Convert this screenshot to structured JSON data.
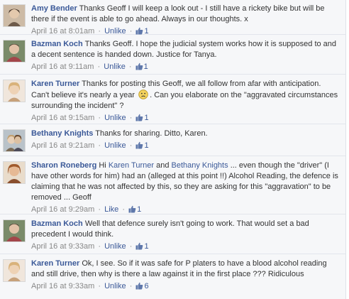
{
  "comments": [
    {
      "author": "Amy Bender",
      "text": "Thanks Geoff I will keep a look out - I still have a rickety bike but will be there if the event is able to go ahead. Always in our thoughts. x",
      "timestamp": "April 16 at 8:01am",
      "action": "Unlike",
      "likes": "1",
      "avatar_colors": [
        "#c9b8a6",
        "#6d5a4a"
      ]
    },
    {
      "author": "Bazman Koch",
      "text": "Thanks Geoff. I hope the judicial system works how it is supposed to and a decent sentence is handed down. Justice for Tanya.",
      "timestamp": "April 16 at 9:11am",
      "action": "Unlike",
      "likes": "1",
      "avatar_colors": [
        "#a3464a",
        "#e2c2a8"
      ]
    },
    {
      "author": "Karen Turner",
      "text_before": "Thanks for posting this Geoff, we all follow from afar with anticipation. Can't believe it's nearly a year",
      "text_after": ". Can you elaborate on the \"aggravated circumstances surrounding the incident\" ?",
      "emoticon": "frown-emoticon",
      "timestamp": "April 16 at 9:15am",
      "action": "Unlike",
      "likes": "1",
      "avatar_colors": [
        "#e8d3b8",
        "#c7a17a"
      ]
    },
    {
      "author": "Bethany Knights",
      "text": "Thanks for sharing. Ditto, Karen.",
      "timestamp": "April 16 at 9:21am",
      "action": "Unlike",
      "likes": "1",
      "avatar_colors": [
        "#c8bca8",
        "#7a6a55"
      ]
    },
    {
      "author": "Sharon Roneberg",
      "text_prefix": "Hi",
      "mention1": "Karen Turner",
      "text_and": "and",
      "mention2": "Bethany Knights",
      "text_rest": "... even though the \"driver\" (I have other words for him) had an (alleged at this point !!) Alcohol Reading, the defence is claiming that he was not affected by this, so they are asking for this \"aggravation\" to be removed ... Geoff",
      "timestamp": "April 16 at 9:29am",
      "action": "Like",
      "likes": "1",
      "avatar_colors": [
        "#d9a67c",
        "#8a4f2e"
      ]
    },
    {
      "author": "Bazman Koch",
      "text": "Well that defence surely isn't going to work. That would set a bad precedent I would think.",
      "timestamp": "April 16 at 9:33am",
      "action": "Unlike",
      "likes": "1",
      "avatar_colors": [
        "#a3464a",
        "#e2c2a8"
      ]
    },
    {
      "author": "Karen Turner",
      "text": "Ok, I see. So if it was safe for P platers to have a blood alcohol reading and still drive, then why is there a law against it in the first place ??? Ridiculous",
      "timestamp": "April 16 at 9:33am",
      "action": "Unlike",
      "likes": "6",
      "avatar_colors": [
        "#e8d3b8",
        "#c7a17a"
      ]
    }
  ],
  "separator": "·",
  "colors": {
    "link": "#3b5998",
    "meta": "#888888",
    "background": "#f6f7f9",
    "divider": "#e2e5ec"
  }
}
